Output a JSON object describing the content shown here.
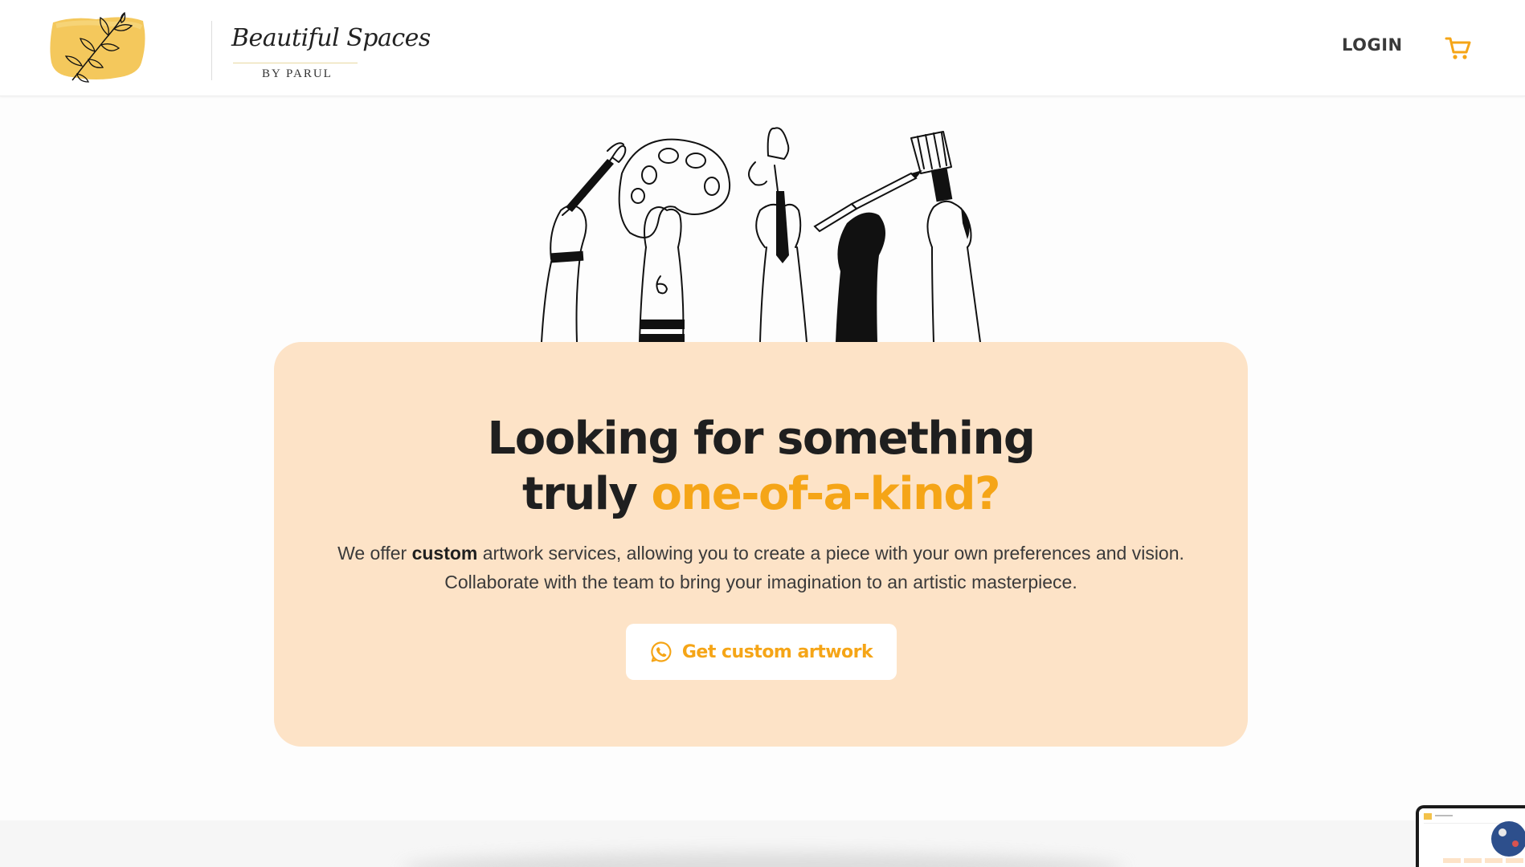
{
  "header": {
    "logo": {
      "script_text": "Beautiful Spaces",
      "subtitle": "BY PARUL"
    },
    "login_label": "LOGIN",
    "cart_icon": "shopping-cart-icon"
  },
  "hero": {
    "illustration": "hands-holding-art-tools-illustration",
    "title_line1": "Looking for something",
    "title_line2_plain": "truly ",
    "title_line2_accent": "one-of-a-kind?",
    "desc_prefix": "We offer ",
    "desc_bold": "custom",
    "desc_suffix": " artwork services, allowing you to create a piece with your own preferences and vision.",
    "desc_line2": "Collaborate with the team to bring your imagination to an artistic masterpiece.",
    "cta_label": "Get custom artwork",
    "cta_icon": "whatsapp-icon"
  },
  "colors": {
    "accent": "#f5a517",
    "card_bg": "#fde3c7",
    "logo_swatch": "#f3c24a"
  }
}
